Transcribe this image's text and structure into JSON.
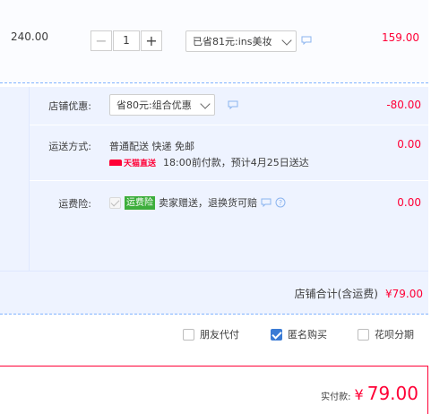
{
  "item": {
    "unit_price": "240.00",
    "quantity": "1",
    "minus_symbol": "−",
    "plus_symbol": "+",
    "discount_select": "已省81元:ins美妆",
    "item_total": "159.00"
  },
  "promo": {
    "shop_discount_label": "店铺优惠:",
    "shop_discount_select": "省80元:组合优惠",
    "shop_discount_amount": "-80.00",
    "shipping_label": "运送方式:",
    "shipping_method": "普通配送 快递 免邮",
    "tmall_logo_text": "天猫直送",
    "shipping_note": "18:00前付款，预计4月25日送达",
    "shipping_fee": "0.00",
    "insurance_label": "运费险:",
    "insurance_badge": "运费险",
    "insurance_text": "卖家赠送，退换货可赔",
    "insurance_fee": "0.00",
    "shop_total_label": "店铺合计(含运费)",
    "shop_total": "¥79.00"
  },
  "options": {
    "friend_pay": "朋友代付",
    "friend_pay_checked": false,
    "anonymous": "匿名购买",
    "anonymous_checked": true,
    "huabei": "花呗分期",
    "huabei_checked": false
  },
  "payment": {
    "label": "实付款:",
    "symbol": "¥",
    "amount": "79.00"
  },
  "colors": {
    "accent_red": "#ff0036",
    "panel_bg": "#eef3ff",
    "checkbox_blue": "#3a7bd5",
    "insurance_green": "#3dae3c"
  }
}
